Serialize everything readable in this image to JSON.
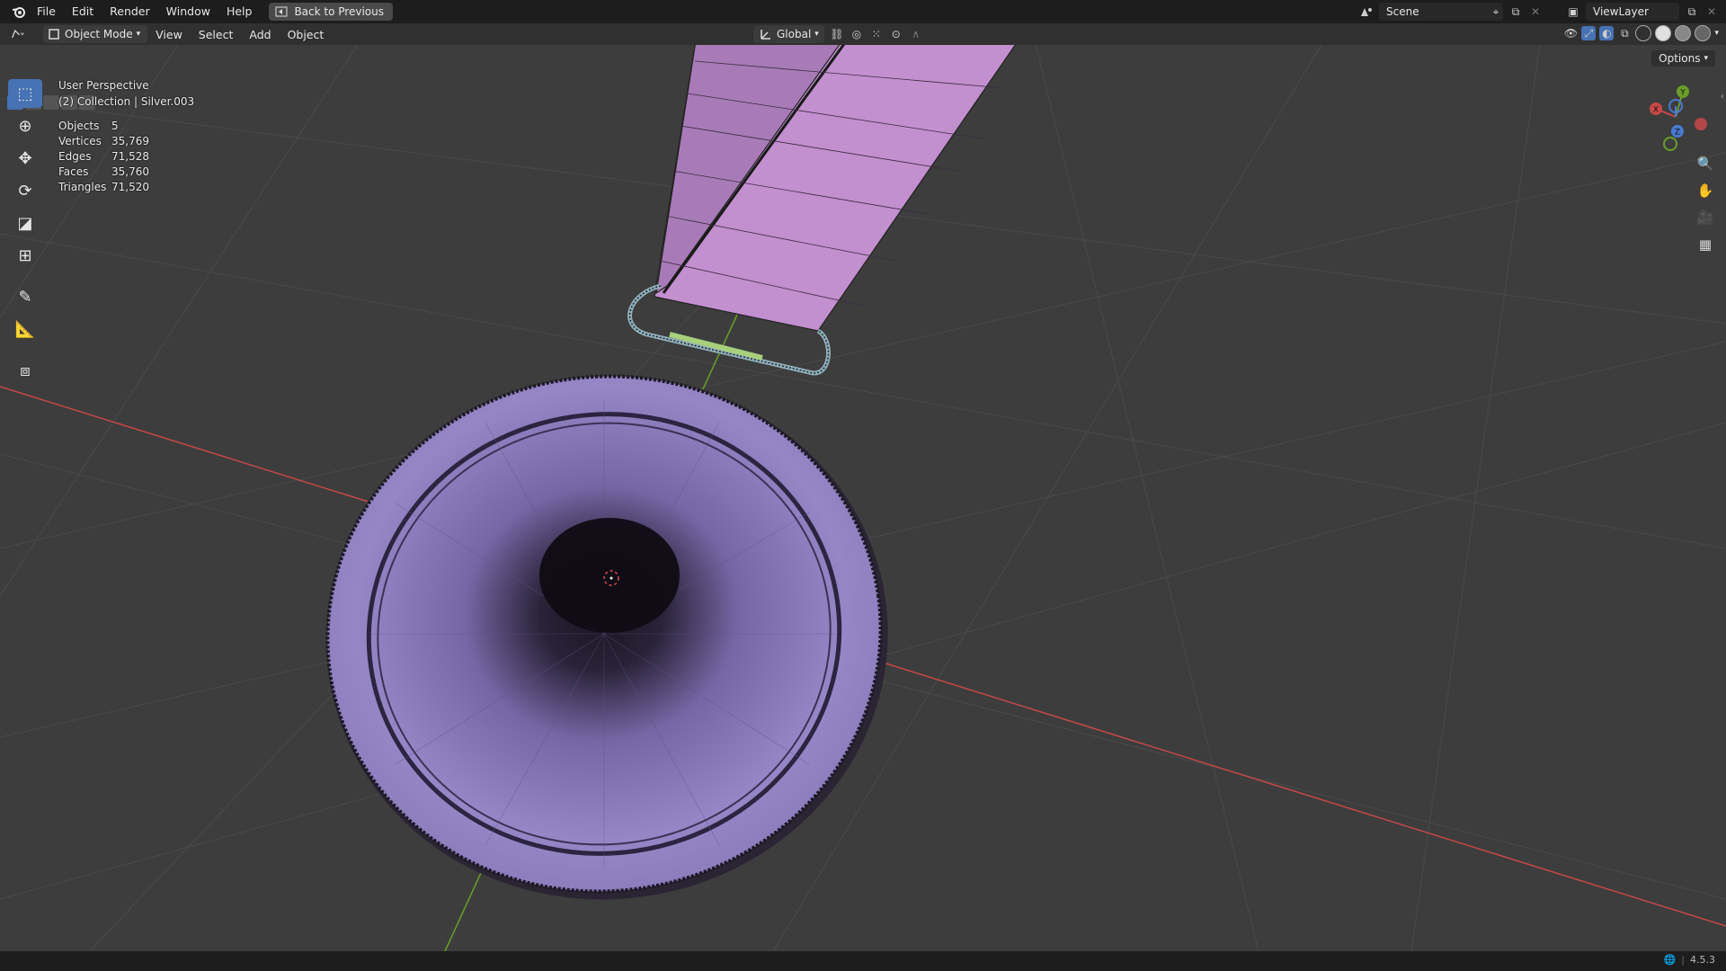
{
  "topbar": {
    "menus": [
      "File",
      "Edit",
      "Render",
      "Window",
      "Help"
    ],
    "back_label": "Back to Previous",
    "scene_label": "Scene",
    "view_layer_label": "ViewLayer"
  },
  "header": {
    "mode": "Object Mode",
    "menus": [
      "View",
      "Select",
      "Add",
      "Object"
    ],
    "orientation": "Global"
  },
  "viewport": {
    "perspective": "User Perspective",
    "collection": "(2) Collection | Silver.003",
    "stats": [
      {
        "label": "Objects",
        "value": "5"
      },
      {
        "label": "Vertices",
        "value": "35,769"
      },
      {
        "label": "Edges",
        "value": "71,528"
      },
      {
        "label": "Faces",
        "value": "35,760"
      },
      {
        "label": "Triangles",
        "value": "71,520"
      }
    ],
    "options_label": "Options",
    "axis_labels": {
      "x": "X",
      "y": "Y",
      "z": "Z"
    }
  },
  "toolbar": {
    "tools": [
      "select-box",
      "cursor",
      "move",
      "rotate",
      "scale",
      "transform",
      "annotate",
      "measure",
      "add-cube"
    ],
    "active": "select-box"
  },
  "status": {
    "version": "4.5.3"
  },
  "colors": {
    "accent": "#4772b3",
    "medal": "#9484c4",
    "ribbon": "#c28fcf",
    "x_axis": "#c84848",
    "y_axis": "#6a9e2a"
  }
}
